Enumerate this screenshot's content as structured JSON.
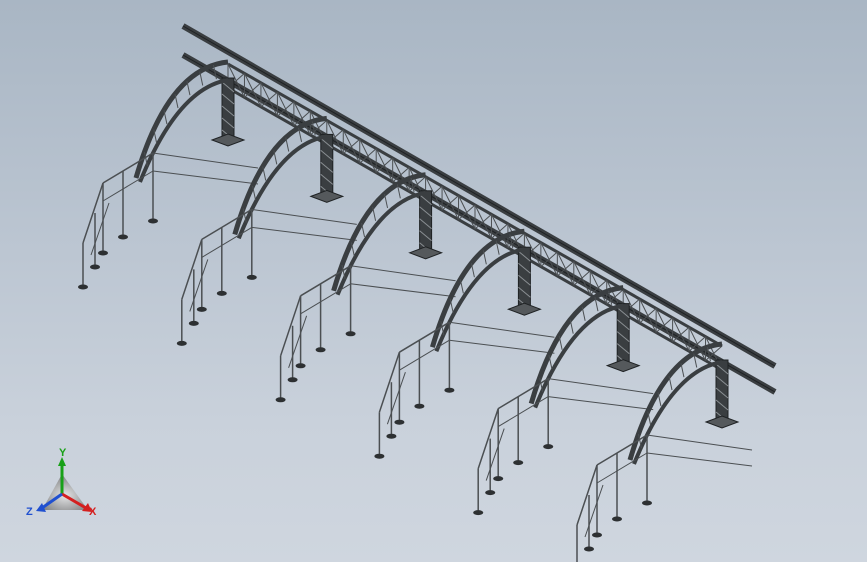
{
  "viewport": {
    "background_top": "#a9b6c4",
    "background_bottom": "#cfd6df",
    "model_color": "#3a3e41",
    "model_edge_color": "#1f2224",
    "railing_color": "#4b4f52",
    "bay_count": 6
  },
  "triad": {
    "x_label": "X",
    "y_label": "Y",
    "z_label": "Z",
    "x_color": "#d42020",
    "y_color": "#18a018",
    "z_color": "#2050d0"
  }
}
